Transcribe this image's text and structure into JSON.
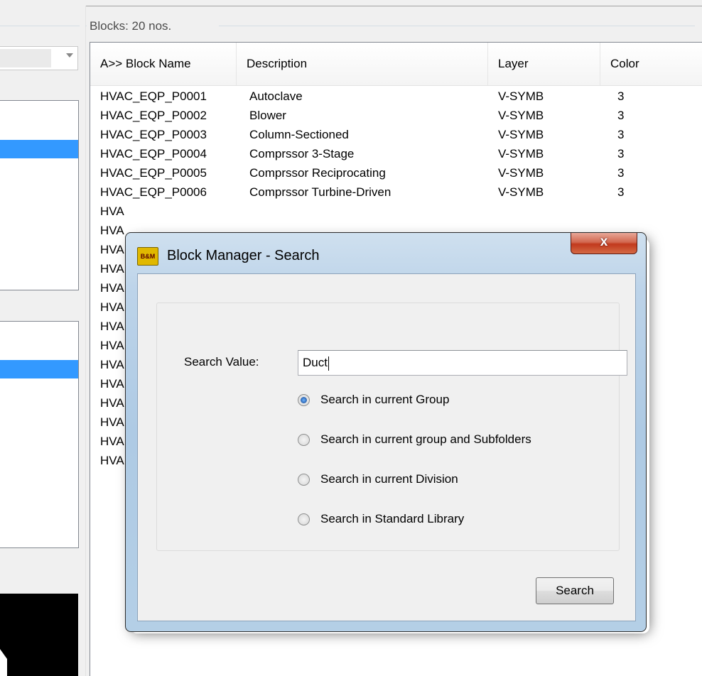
{
  "blocks_panel": {
    "count_label": "Blocks: 20 nos.",
    "columns": [
      "A>> Block Name",
      "Description",
      "Layer",
      "Color"
    ],
    "rows": [
      {
        "name": "HVAC_EQP_P0001",
        "description": "Autoclave",
        "layer": "V-SYMB",
        "color": "3"
      },
      {
        "name": "HVAC_EQP_P0002",
        "description": "Blower",
        "layer": "V-SYMB",
        "color": "3"
      },
      {
        "name": "HVAC_EQP_P0003",
        "description": "Column-Sectioned",
        "layer": "V-SYMB",
        "color": "3"
      },
      {
        "name": "HVAC_EQP_P0004",
        "description": "Comprssor 3-Stage",
        "layer": "V-SYMB",
        "color": "3"
      },
      {
        "name": "HVAC_EQP_P0005",
        "description": "Comprssor Reciprocating",
        "layer": "V-SYMB",
        "color": "3"
      },
      {
        "name": "HVAC_EQP_P0006",
        "description": "Comprssor Turbine-Driven",
        "layer": "V-SYMB",
        "color": "3"
      },
      {
        "name": "HVA",
        "description": "",
        "layer": "",
        "color": ""
      },
      {
        "name": "HVA",
        "description": "",
        "layer": "",
        "color": ""
      },
      {
        "name": "HVA",
        "description": "",
        "layer": "",
        "color": ""
      },
      {
        "name": "HVA",
        "description": "",
        "layer": "",
        "color": ""
      },
      {
        "name": "HVA",
        "description": "",
        "layer": "",
        "color": ""
      },
      {
        "name": "HVA",
        "description": "",
        "layer": "",
        "color": ""
      },
      {
        "name": "HVA",
        "description": "",
        "layer": "",
        "color": ""
      },
      {
        "name": "HVA",
        "description": "",
        "layer": "",
        "color": ""
      },
      {
        "name": "HVA",
        "description": "",
        "layer": "",
        "color": ""
      },
      {
        "name": "HVA",
        "description": "",
        "layer": "",
        "color": ""
      },
      {
        "name": "HVA",
        "description": "",
        "layer": "",
        "color": ""
      },
      {
        "name": "HVA",
        "description": "",
        "layer": "",
        "color": ""
      },
      {
        "name": "HVA",
        "description": "",
        "layer": "",
        "color": ""
      },
      {
        "name": "HVA",
        "description": "",
        "layer": "",
        "color": ""
      }
    ]
  },
  "dialog": {
    "icon_text": "B&M",
    "title": "Block Manager - Search",
    "close_glyph": "x",
    "search_label": "Search Value:",
    "search_value": "Duct",
    "options": [
      {
        "label": "Search in current Group",
        "checked": true
      },
      {
        "label": "Search in current group and Subfolders",
        "checked": false
      },
      {
        "label": "Search in current Division",
        "checked": false
      },
      {
        "label": "Search in Standard Library",
        "checked": false
      }
    ],
    "search_button": "Search"
  },
  "colors": {
    "selection": "#3399ff",
    "dialog_frame": "#b4cfe6",
    "close_button": "#c1391d"
  }
}
